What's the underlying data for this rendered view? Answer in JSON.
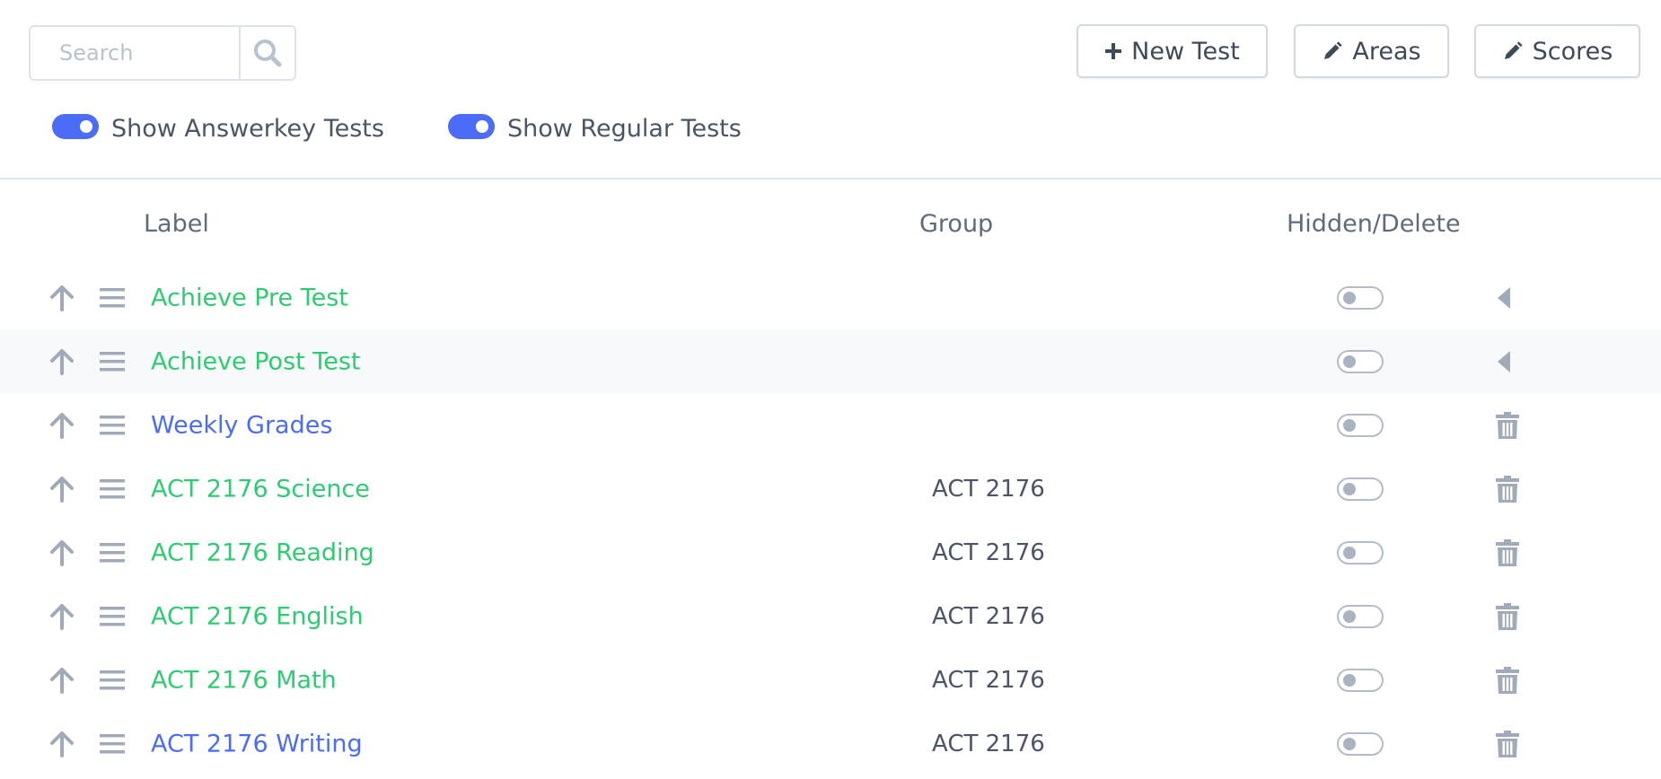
{
  "search": {
    "placeholder": "Search"
  },
  "toolbar": {
    "new_test_label": "New Test",
    "areas_label": "Areas",
    "scores_label": "Scores"
  },
  "filters": {
    "answerkey_label": "Show Answerkey Tests",
    "answerkey_on": true,
    "regular_label": "Show Regular Tests",
    "regular_on": true
  },
  "table": {
    "headers": {
      "label": "Label",
      "group": "Group",
      "hidden_delete": "Hidden/Delete"
    },
    "rows": [
      {
        "label": "Achieve Pre Test",
        "group": "",
        "label_color": "#2ecc71",
        "action_icon": "caret-left-icon",
        "hidden": false
      },
      {
        "label": "Achieve Post Test",
        "group": "",
        "label_color": "#2ecc71",
        "action_icon": "caret-left-icon",
        "hidden": false
      },
      {
        "label": "Weekly Grades",
        "group": "",
        "label_color": "#4a6cf7",
        "action_icon": "trash-icon",
        "hidden": false
      },
      {
        "label": "ACT 2176 Science",
        "group": "ACT 2176",
        "label_color": "#2ecc71",
        "action_icon": "trash-icon",
        "hidden": false
      },
      {
        "label": "ACT 2176 Reading",
        "group": "ACT 2176",
        "label_color": "#2ecc71",
        "action_icon": "trash-icon",
        "hidden": false
      },
      {
        "label": "ACT 2176 English",
        "group": "ACT 2176",
        "label_color": "#2ecc71",
        "action_icon": "trash-icon",
        "hidden": false
      },
      {
        "label": "ACT 2176 Math",
        "group": "ACT 2176",
        "label_color": "#2ecc71",
        "action_icon": "trash-icon",
        "hidden": false
      },
      {
        "label": "ACT 2176 Writing",
        "group": "ACT 2176",
        "label_color": "#4a6cf7",
        "action_icon": "trash-icon",
        "hidden": false
      }
    ]
  },
  "colors": {
    "accent": "#4a6cf7",
    "green": "#2ecc71",
    "icon_gray": "#a0aab8"
  }
}
